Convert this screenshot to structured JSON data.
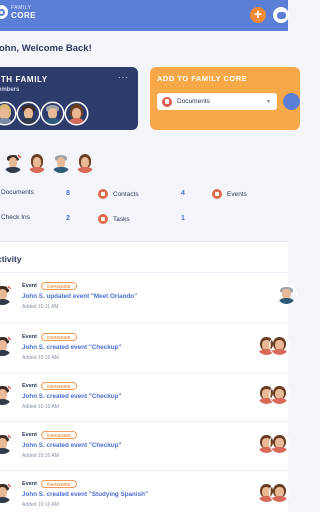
{
  "header": {
    "logo_small": "FAMILY",
    "logo_big": "CORE",
    "add_icon": "plus-icon",
    "chat_icon": "chat-icon",
    "accent_color": "#5b7fd6"
  },
  "welcome": "ohn, Welcome Back!",
  "family_card": {
    "title": "ITH FAMILY",
    "subtitle": "embers",
    "more": "···"
  },
  "add_card": {
    "title": "ADD TO FAMILY CORE",
    "selected": "Documents",
    "caret": "▼"
  },
  "counts": [
    {
      "label": "Documents",
      "value": "8"
    },
    {
      "label": "Contacts",
      "value": "4"
    },
    {
      "label": "Events",
      "value": ""
    },
    {
      "label": "Check Ins",
      "value": "2"
    },
    {
      "label": "Tasks",
      "value": "1"
    }
  ],
  "activity": {
    "title": "ctivity",
    "rows": [
      {
        "type": "Event",
        "badge": "CHANGED",
        "text": "John S. updated event \"Meet Orlando\"",
        "time": "Added 10:11 AM"
      },
      {
        "type": "Event",
        "badge": "CHANGED",
        "text": "John S. created event \"Checkup\"",
        "time": "Added 10:10 AM"
      },
      {
        "type": "Event",
        "badge": "CHANGED",
        "text": "John S. created event \"Checkup\"",
        "time": "Added 10:10 AM"
      },
      {
        "type": "Event",
        "badge": "CHANGED",
        "text": "John S. created event \"Checkup\"",
        "time": "Added 10:10 AM"
      },
      {
        "type": "Event",
        "badge": "CHANGED",
        "text": "John S. created event \"Studying Spanish\"",
        "time": "Added 10:10 AM"
      }
    ]
  }
}
